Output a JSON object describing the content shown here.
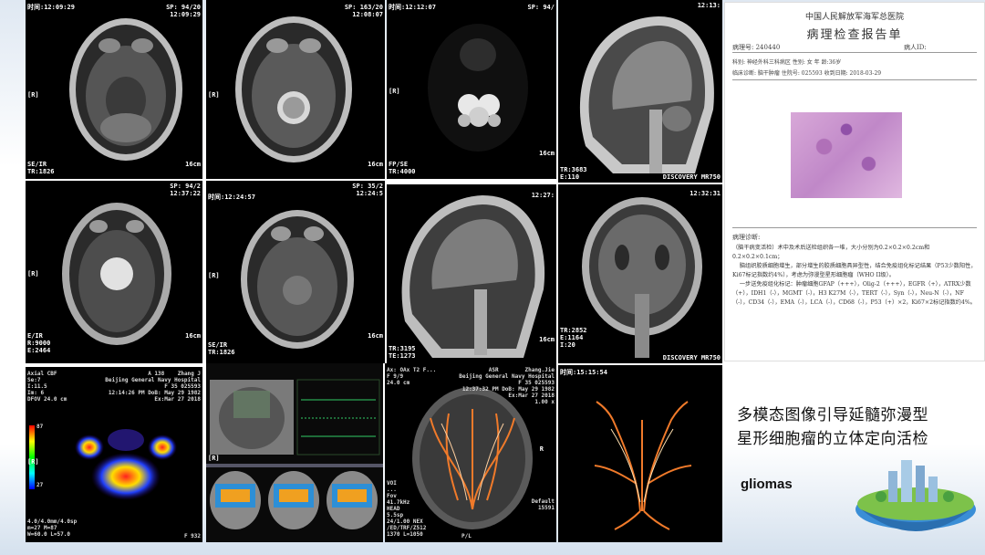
{
  "slide": {
    "caption_line1": "多模态图像引导延髓弥漫型",
    "caption_line2": "星形细胞瘤的立体定向活检",
    "keyword": "gliomas"
  },
  "row1": [
    {
      "tl": "时间:12:09:29",
      "tr": "SP: 94/20\n12:09:29",
      "side": "[R]",
      "bl": "SE/IR\nTR:1826",
      "br": "16cm"
    },
    {
      "tl": "",
      "tr": "SP: 163/20\n12:08:07",
      "side": "[R]",
      "bl": "",
      "br": "16cm"
    },
    {
      "tl": "时间:12:12:07",
      "tr": "SP: 94/",
      "side": "[R]",
      "bl": "FP/SE\nTR:4000",
      "br": "16cm"
    },
    {
      "tl": "",
      "tr": "12:13:",
      "side": "",
      "bl": "TR:3683\nE:110",
      "br": "DISCOVERY MR750"
    }
  ],
  "row2": [
    {
      "tl": "",
      "tr": "SP: 94/2\n12:37:22",
      "side": "[R]",
      "bl": "E/IR\nR:9000\nE:2464",
      "br": "16cm"
    },
    {
      "tl": "时间:12:24:57",
      "tr": "SP: 35/2\n12:24:5",
      "side": "[R]",
      "bl": "SE/IR\nTR:1826",
      "br": "16cm"
    },
    {
      "tl": "",
      "tr": "12:27:",
      "side": "",
      "bl": "TR:3195\nTE:1273",
      "br": "16cm"
    },
    {
      "tl": "",
      "tr": "12:32:31",
      "side": "",
      "bl": "TR:2852\nE:1164\nI:20",
      "br": "DISCOVERY MR750"
    }
  ],
  "row3": [
    {
      "tl": "Axial CBF\nSe:7\nI:11.5\nIm: 6\nDFOV 24.0 cm",
      "tr": "A 138    Zhang J\nBeijing General Navy Hospital\nF 35 025593\n12:14:26 PM DoB: May 29 1982\nEx:Mar 27 2018",
      "bl": "4.0/4.0mm/4.0sp\nm=27 M=87\nW=60.0 L=57.0",
      "br": "F 932",
      "scale_top": "87",
      "scale_mid": "57",
      "scale_bot": "27",
      "side": "[R]"
    },
    {
      "tl": "",
      "tr": "",
      "bl": "",
      "br": "",
      "side": "[R]"
    },
    {
      "tl": "Ax: OAx T2 F...\nF 9/9\n24.0 cm",
      "tr": "ASR        Zhang.Jie\nBeijing General Navy Hospital\nF 35 025593\n12:37:32 PM DoB: May 29 1982\nEx:Mar 27 2018\n1.00 x",
      "bl": "VOI\n...\nFov\n41.7kHz\nHEAD\n5.5sp\n24/1.00 NEX\n/ED/TRF/Z512\n1370 L=1050",
      "br": "Default\n15591",
      "side": "R",
      "bottom": "P/L"
    },
    {
      "tl": "时间:15:15:54",
      "tr": "",
      "bl": "",
      "br": "",
      "side": ""
    }
  ],
  "report": {
    "hospital": "中国人民解放军海军总医院",
    "title": "病理检查报告单",
    "pathology_no_label": "病理号: 240440",
    "ward_label": "病人ID:",
    "row1": "科别: 神经外科三科病区      性别: 女              年  龄:36岁",
    "row2": "临床诊断: 脑干肿瘤              住院号: 025593        收到日期: 2018-03-29",
    "diagnosis_label": "病理诊断:",
    "diagnosis_text": "（脑干病变活检）术中及术后送检组织各一堆，大小分别为0.2×0.2×0.2cm和0.2×0.2×0.1cm；\n    脑组织胶质细胞增生，部分增生的胶质细胞具异型性，结合免疫组化标记结果（P53少数阳性，Ki67标记指数约4%），考虑为弥漫型星形细胞瘤（WHO II级）。\n    一步送免疫组化标记：肿瘤细胞GFAP（+++），Olig-2（+++），EGFR（+），ATRX少数（+），IDH1（-），MGMT（-），H3 K27M（-），TERT（-），Syn（-），Neu-N（-），NF（-），CD34（-），EMA（-），LCA（-），CD68（-），P53（+）×2，Ki67×2标记指数约4%。"
  },
  "colors": {
    "background": "#ffffff",
    "tile_bg": "#000000",
    "fiber": "#f07a2a",
    "cbf_hot": "#ff2020"
  }
}
